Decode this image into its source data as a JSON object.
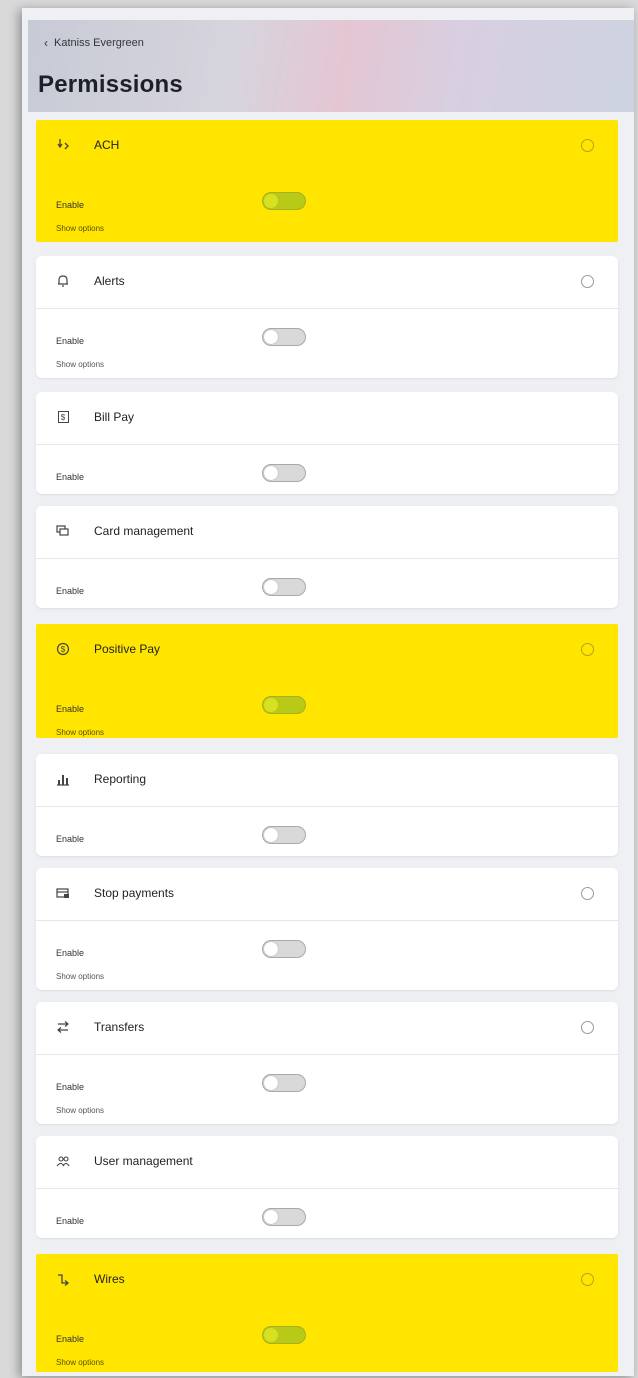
{
  "header": {
    "back_label": "Katniss Evergreen",
    "title": "Permissions"
  },
  "common": {
    "enable_label": "Enable",
    "show_options_label": "Show options"
  },
  "cards": [
    {
      "key": "ach",
      "label": "ACH",
      "icon": "ach-icon",
      "highlighted": true,
      "enabled": true,
      "has_info": true,
      "has_options": true
    },
    {
      "key": "alerts",
      "label": "Alerts",
      "icon": "bell-icon",
      "highlighted": false,
      "enabled": false,
      "has_info": true,
      "has_options": true
    },
    {
      "key": "bill-pay",
      "label": "Bill Pay",
      "icon": "dollar-box-icon",
      "highlighted": false,
      "enabled": false,
      "has_info": false,
      "has_options": false
    },
    {
      "key": "card-management",
      "label": "Card management",
      "icon": "cards-icon",
      "highlighted": false,
      "enabled": false,
      "has_info": false,
      "has_options": false
    },
    {
      "key": "positive-pay",
      "label": "Positive Pay",
      "icon": "dollar-circle-icon",
      "highlighted": true,
      "enabled": true,
      "has_info": true,
      "has_options": true
    },
    {
      "key": "reporting",
      "label": "Reporting",
      "icon": "bar-chart-icon",
      "highlighted": false,
      "enabled": false,
      "has_info": false,
      "has_options": false
    },
    {
      "key": "stop-payments",
      "label": "Stop payments",
      "icon": "stop-payment-icon",
      "highlighted": false,
      "enabled": false,
      "has_info": true,
      "has_options": true
    },
    {
      "key": "transfers",
      "label": "Transfers",
      "icon": "transfer-arrows-icon",
      "highlighted": false,
      "enabled": false,
      "has_info": true,
      "has_options": true
    },
    {
      "key": "user-management",
      "label": "User management",
      "icon": "users-icon",
      "highlighted": false,
      "enabled": false,
      "has_info": false,
      "has_options": false
    },
    {
      "key": "wires",
      "label": "Wires",
      "icon": "wires-icon",
      "highlighted": true,
      "enabled": true,
      "has_info": true,
      "has_options": true
    }
  ],
  "colors": {
    "highlight": "#ffe500",
    "toggle_on": "#b9c918",
    "toggle_off": "#d9d9d9"
  }
}
